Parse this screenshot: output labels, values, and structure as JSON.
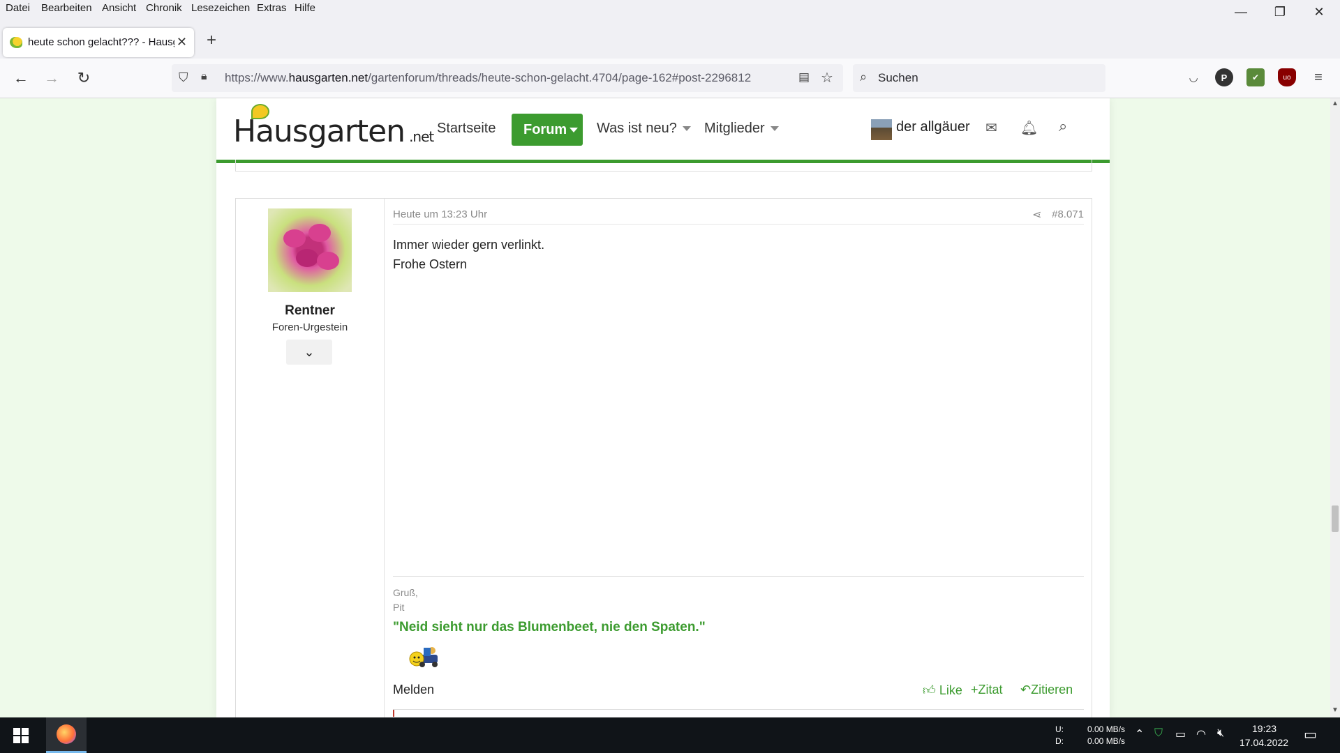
{
  "menu": [
    "Datei",
    "Bearbeiten",
    "Ansicht",
    "Chronik",
    "Lesezeichen",
    "Extras",
    "Hilfe"
  ],
  "window_controls": {
    "minimize": "—",
    "restore": "❐",
    "close": "✕"
  },
  "tab": {
    "title": "heute schon gelacht??? - Hausgarten.net",
    "close": "✕",
    "new": "+"
  },
  "nav": {
    "url_prefix": "https://www.",
    "url_domain": "hausgarten.net",
    "url_path": "/gartenforum/threads/heute-schon-gelacht.4704/page-162#post-2296812",
    "search_placeholder": "Suchen"
  },
  "site": {
    "logo": "Hausgarten",
    "logo_suffix": ".net",
    "nav": {
      "home": "Startseite",
      "forum": "Forum",
      "whats_new": "Was ist neu?",
      "members": "Mitglieder"
    },
    "user": "der allgäuer"
  },
  "post": {
    "date": "Heute um 13:23 Uhr",
    "number": "#8.071",
    "author": "Rentner",
    "author_title": "Foren-Urgestein",
    "text_line1": "Immer wieder gern verlinkt.",
    "text_line2": "Frohe Ostern",
    "sig_greeting": "Gruß,",
    "sig_name": "Pit",
    "sig_quote": "\"Neid sieht nur das Blumenbeet, nie den Spaten.\"",
    "report": "Melden",
    "like": "Like",
    "quote": "Zitat",
    "reply": "Zitieren"
  },
  "taskbar": {
    "net_u_label": "U:",
    "net_d_label": "D:",
    "net_u": "0.00 MB/s",
    "net_d": "0.00 MB/s",
    "time": "19:23",
    "date": "17.04.2022"
  },
  "colors": {
    "accent": "#3c9b2f",
    "page_bg": "#eefaea"
  }
}
